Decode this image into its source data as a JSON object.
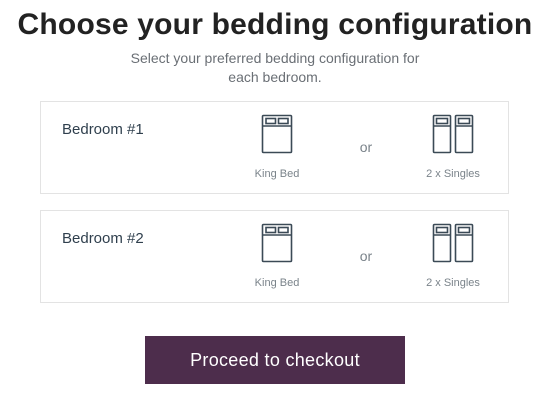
{
  "header": {
    "title": "Choose your bedding configuration",
    "subtitle_line1": "Select your preferred bedding configuration for",
    "subtitle_line2": "each bedroom."
  },
  "bedrooms": [
    {
      "title": "Bedroom #1",
      "options": [
        {
          "label": "King Bed",
          "icon": "king-bed-icon"
        },
        {
          "label": "2 x Singles",
          "icon": "twin-beds-icon"
        }
      ],
      "or_label": "or"
    },
    {
      "title": "Bedroom #2",
      "options": [
        {
          "label": "King Bed",
          "icon": "king-bed-icon"
        },
        {
          "label": "2 x Singles",
          "icon": "twin-beds-icon"
        }
      ],
      "or_label": "or"
    }
  ],
  "checkout": {
    "label": "Proceed to checkout"
  },
  "colors": {
    "cta_background": "#4d2d4c",
    "icon_stroke": "#3b4a56"
  }
}
